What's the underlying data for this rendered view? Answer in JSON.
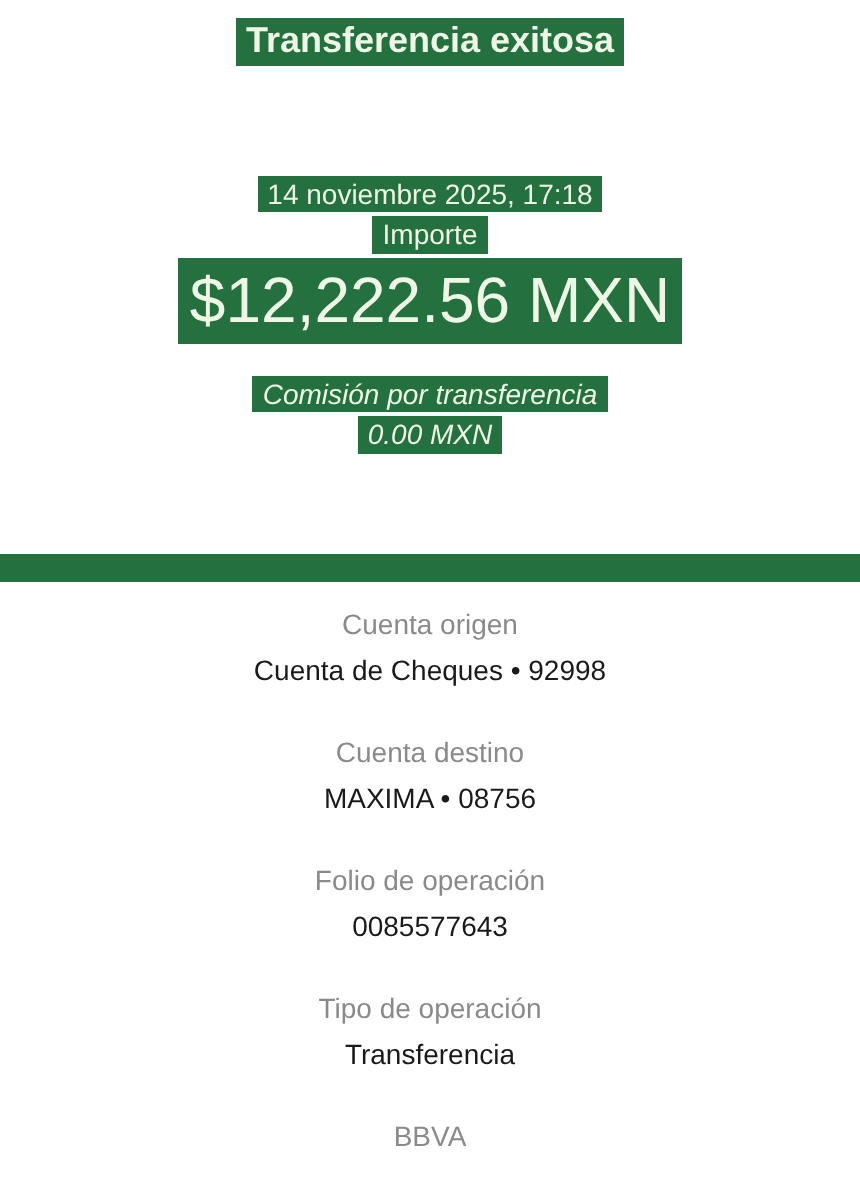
{
  "title": "Transferencia exitosa",
  "date": "14 noviembre 2025, 17:18",
  "amount_label": "Importe",
  "amount": "$12,222.56 MXN",
  "fee_label": "Comisión por transferencia",
  "fee": "0.00 MXN",
  "details": [
    {
      "label": "Cuenta origen",
      "value": "Cuenta de Cheques • 92998"
    },
    {
      "label": "Cuenta destino",
      "value": "MAXIMA • 08756"
    },
    {
      "label": "Folio de operación",
      "value": "0085577643"
    },
    {
      "label": "Tipo de operación",
      "value": "Transferencia"
    }
  ],
  "bank": "BBVA"
}
